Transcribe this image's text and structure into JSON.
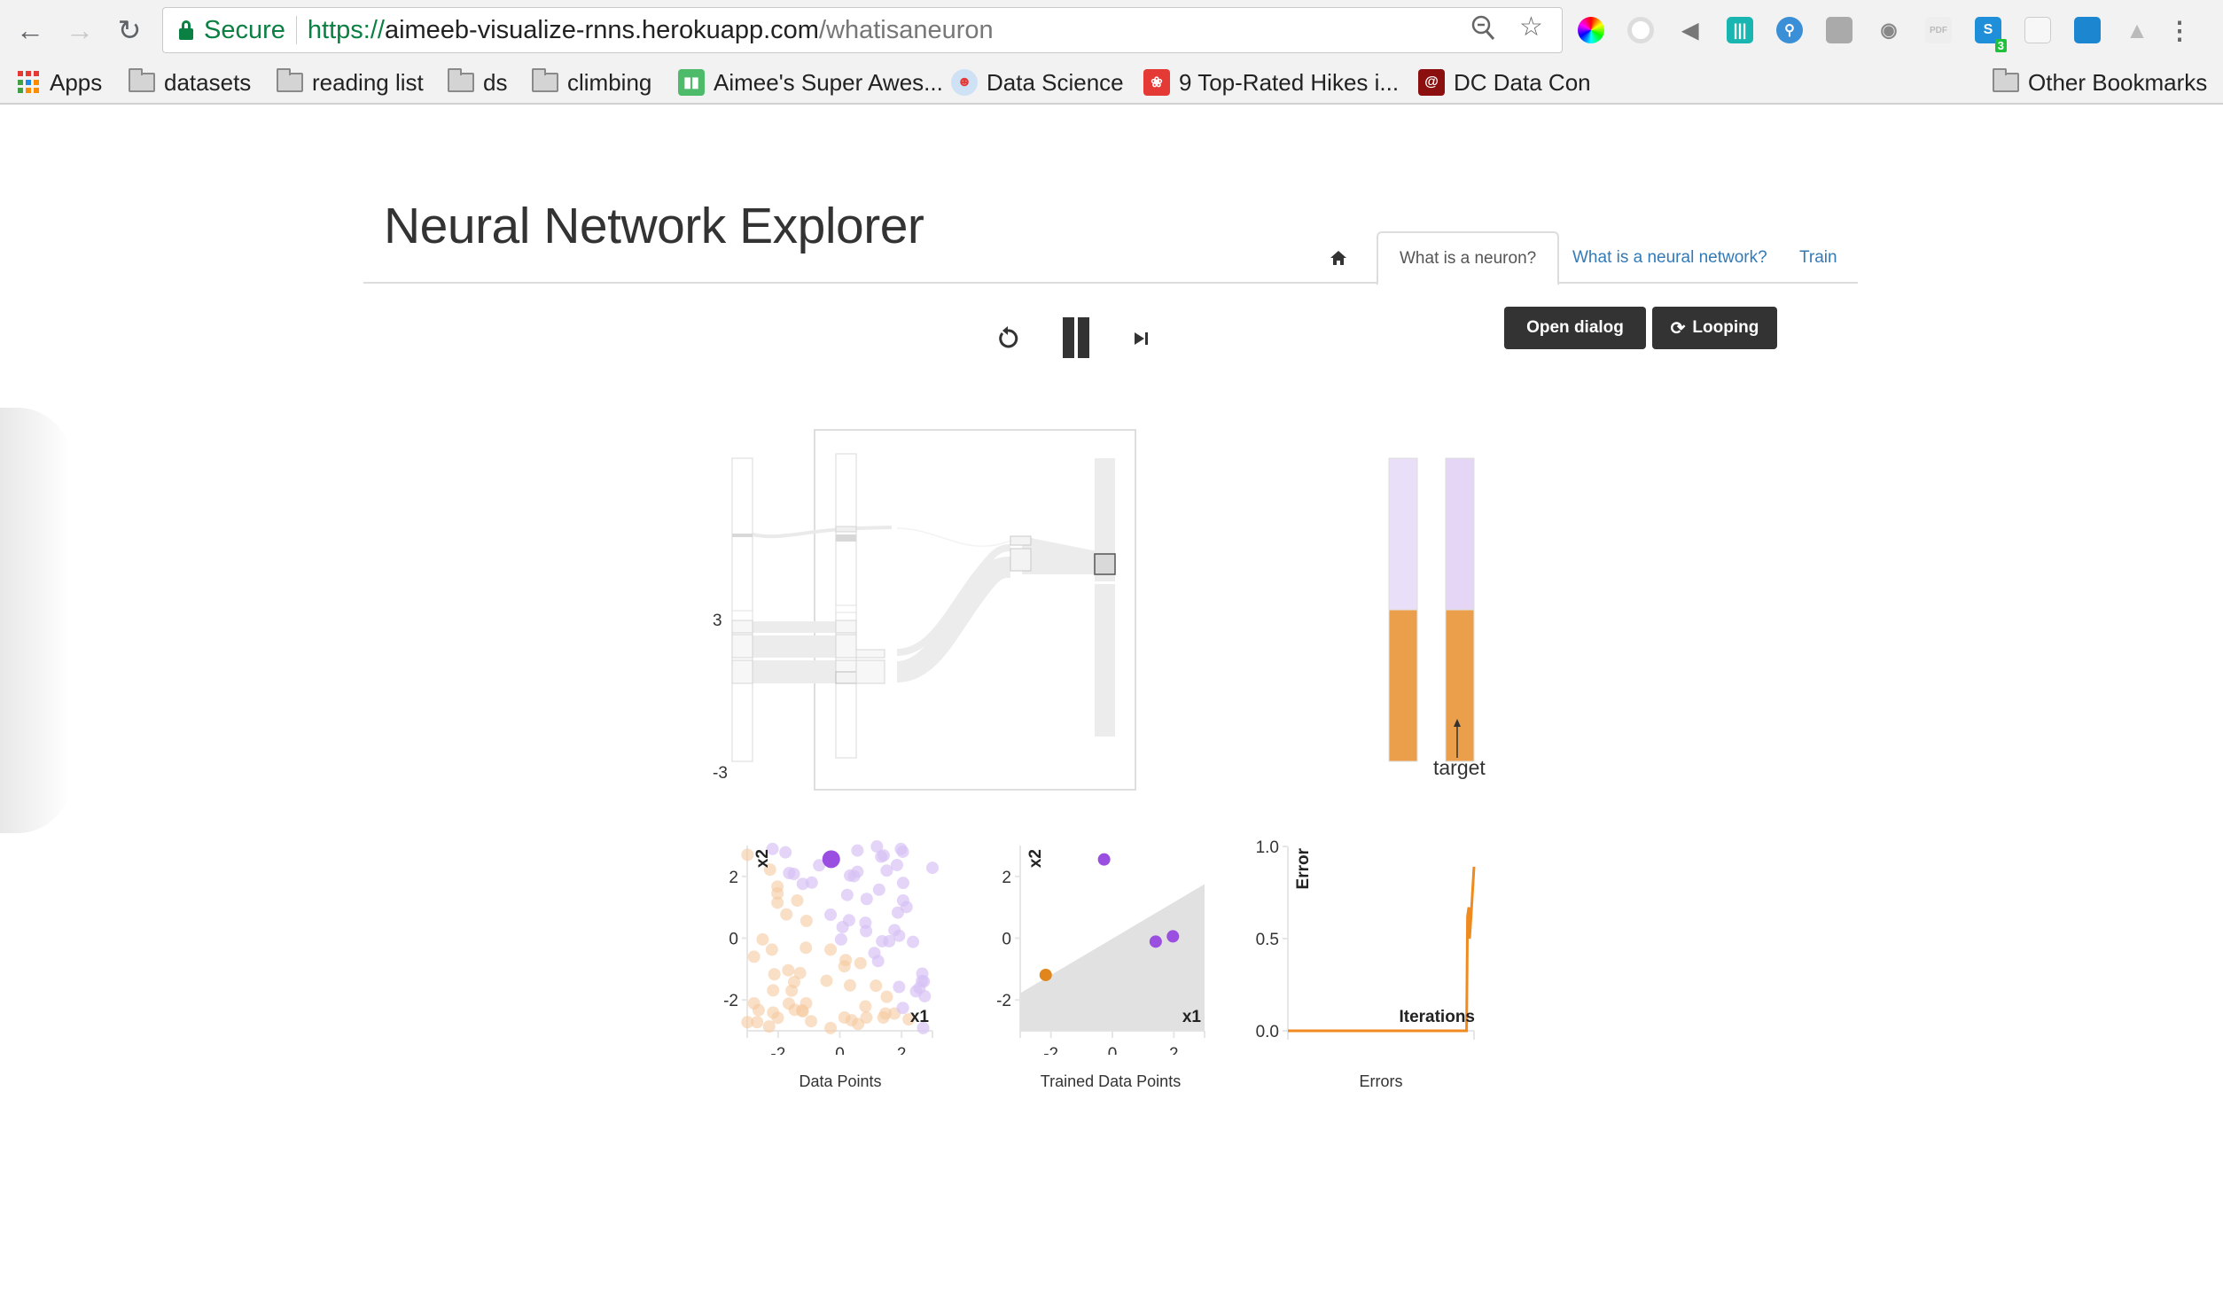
{
  "browser": {
    "back_icon": "arrow-left-icon",
    "forward_icon": "arrow-right-icon",
    "reload_icon": "reload-icon",
    "security_label": "Secure",
    "url_scheme": "https://",
    "url_host": "aimeeb-visualize-rnns.herokuapp.com",
    "url_path": "/whatisaneuron",
    "zoom_icon": "zoom-out-icon",
    "bookmark_star_icon": "star-icon",
    "extensions": [
      {
        "name": "color-picker-extension-icon"
      },
      {
        "name": "crescent-extension-icon"
      },
      {
        "name": "speaker-extension-icon"
      },
      {
        "name": "columns-extension-icon"
      },
      {
        "name": "search-extension-icon"
      },
      {
        "name": "note-extension-icon"
      },
      {
        "name": "camera-extension-icon"
      },
      {
        "name": "pdfjs-extension-icon",
        "label": "PDF"
      },
      {
        "name": "skype-extension-icon",
        "label": "S",
        "badge": "3"
      },
      {
        "name": "document-extension-icon"
      },
      {
        "name": "trello-extension-icon"
      },
      {
        "name": "drive-extension-icon"
      }
    ],
    "menu_icon": "more-vertical-icon",
    "bookmarks": [
      {
        "label": "Apps",
        "icon": "apps-grid-icon"
      },
      {
        "label": "datasets",
        "icon": "folder-icon"
      },
      {
        "label": "reading list",
        "icon": "folder-icon"
      },
      {
        "label": "ds",
        "icon": "folder-icon"
      },
      {
        "label": "climbing",
        "icon": "folder-icon"
      },
      {
        "label": "Aimee's Super Awes...",
        "icon": "trello-icon"
      },
      {
        "label": "Data Science",
        "icon": "reddit-icon"
      },
      {
        "label": "9 Top-Rated Hikes i...",
        "icon": "hikes-icon"
      },
      {
        "label": "DC Data Con",
        "icon": "dc-data-con-icon"
      }
    ],
    "other_bookmarks": "Other Bookmarks"
  },
  "page": {
    "title": "Neural Network Explorer",
    "tabs": [
      {
        "label": "home",
        "icon": "home-icon",
        "active": false
      },
      {
        "label": "What is a neuron?",
        "active": true
      },
      {
        "label": "What is a neural network?",
        "active": false
      },
      {
        "label": "Train",
        "active": false
      }
    ],
    "controls": {
      "restart_icon": "restart-icon",
      "pause_icon": "pause-icon",
      "step_icon": "step-forward-icon",
      "open_dialog_label": "Open dialog",
      "looping_label": "Looping",
      "looping_icon": "refresh-icon"
    },
    "neuron_diagram": {
      "axis_max_label": "3",
      "axis_min_label": "-3",
      "target_label": "target",
      "output_bars": [
        {
          "name": "prediction",
          "orange_fraction": 0.5
        },
        {
          "name": "target",
          "orange_fraction": 0.5
        }
      ],
      "colors": {
        "orange": "#eb9f4b",
        "lavender": "#eadff8",
        "lavender_target": "#e5d6f6",
        "gray_flow": "#ececec"
      }
    }
  },
  "chart_data": [
    {
      "type": "scatter",
      "title": "Data Points",
      "xlabel": "x1",
      "ylabel": "x2",
      "xlim": [
        -3,
        3
      ],
      "ylim": [
        -3,
        3
      ],
      "xticks": [
        -2,
        0,
        2
      ],
      "yticks": [
        -2,
        0,
        2
      ],
      "series": [
        {
          "name": "class-orange",
          "color": "#f5c9a0",
          "opacity": 0.6,
          "points": [
            [
              -2.99,
              2.7
            ],
            [
              -2.26,
              2.22
            ],
            [
              -2.02,
              1.67
            ],
            [
              -2.02,
              1.45
            ],
            [
              -2.02,
              1.15
            ],
            [
              -1.38,
              1.22
            ],
            [
              -1.73,
              0.77
            ],
            [
              -1.08,
              0.56
            ],
            [
              -2.5,
              -0.04
            ],
            [
              -2.2,
              -0.37
            ],
            [
              -2.78,
              -0.6
            ],
            [
              -1.1,
              -0.31
            ],
            [
              -0.3,
              -0.37
            ],
            [
              0.19,
              -0.71
            ],
            [
              0.15,
              -0.91
            ],
            [
              0.67,
              -0.81
            ],
            [
              -2.12,
              -1.17
            ],
            [
              -1.67,
              -1.04
            ],
            [
              -1.29,
              -1.13
            ],
            [
              -1.48,
              -1.42
            ],
            [
              -1.56,
              -1.7
            ],
            [
              -2.16,
              -1.69
            ],
            [
              -0.43,
              -1.38
            ],
            [
              0.33,
              -1.53
            ],
            [
              1.17,
              -1.54
            ],
            [
              1.52,
              -1.9
            ],
            [
              -2.78,
              -2.11
            ],
            [
              -2.63,
              -2.33
            ],
            [
              -2.16,
              -2.41
            ],
            [
              -2.01,
              -2.58
            ],
            [
              -1.65,
              -2.12
            ],
            [
              -1.46,
              -2.32
            ],
            [
              -1.09,
              -2.11
            ],
            [
              -1.22,
              -2.34
            ],
            [
              -1.2,
              -2.37
            ],
            [
              -2.99,
              -2.72
            ],
            [
              -2.68,
              -2.72
            ],
            [
              -2.29,
              -2.86
            ],
            [
              -0.93,
              -2.69
            ],
            [
              -0.3,
              -2.91
            ],
            [
              0.15,
              -2.57
            ],
            [
              0.38,
              -2.66
            ],
            [
              0.59,
              -2.78
            ],
            [
              0.83,
              -2.21
            ],
            [
              0.86,
              -2.57
            ],
            [
              1.41,
              -2.57
            ],
            [
              1.48,
              -2.44
            ],
            [
              1.77,
              -2.44
            ],
            [
              2.23,
              -2.63
            ]
          ]
        },
        {
          "name": "class-purple",
          "color": "#d7c2f5",
          "opacity": 0.7,
          "points": [
            [
              -2.18,
              2.89
            ],
            [
              -1.76,
              2.78
            ],
            [
              -0.67,
              2.36
            ],
            [
              -1.64,
              2.11
            ],
            [
              -1.49,
              2.08
            ],
            [
              -1.2,
              1.76
            ],
            [
              -0.91,
              1.8
            ],
            [
              0.57,
              2.84
            ],
            [
              1.2,
              2.97
            ],
            [
              1.34,
              2.64
            ],
            [
              1.42,
              2.68
            ],
            [
              1.98,
              2.89
            ],
            [
              2.04,
              2.8
            ],
            [
              1.85,
              2.37
            ],
            [
              1.52,
              2.19
            ],
            [
              3.0,
              2.28
            ],
            [
              0.33,
              2.03
            ],
            [
              0.46,
              2.01
            ],
            [
              0.57,
              2.15
            ],
            [
              2.05,
              1.79
            ],
            [
              0.24,
              1.4
            ],
            [
              0.87,
              1.27
            ],
            [
              1.27,
              1.57
            ],
            [
              2.05,
              1.22
            ],
            [
              2.16,
              1.01
            ],
            [
              -0.3,
              0.76
            ],
            [
              0.3,
              0.58
            ],
            [
              0.09,
              0.36
            ],
            [
              0.83,
              0.5
            ],
            [
              0.85,
              0.23
            ],
            [
              1.88,
              0.83
            ],
            [
              1.77,
              0.26
            ],
            [
              1.92,
              0.08
            ],
            [
              1.37,
              -0.1
            ],
            [
              1.6,
              -0.1
            ],
            [
              2.37,
              -0.12
            ],
            [
              0.04,
              -0.04
            ],
            [
              1.12,
              -0.48
            ],
            [
              1.24,
              -0.74
            ],
            [
              2.67,
              -1.15
            ],
            [
              2.66,
              -1.39
            ],
            [
              2.72,
              -1.4
            ],
            [
              1.92,
              -1.58
            ],
            [
              2.47,
              -1.72
            ],
            [
              2.58,
              -1.61
            ],
            [
              2.75,
              -1.88
            ],
            [
              2.04,
              -2.26
            ],
            [
              2.7,
              -2.91
            ]
          ]
        },
        {
          "name": "current-point",
          "color": "#9b4fe0",
          "opacity": 1,
          "large": true,
          "points": [
            [
              -0.28,
              2.56
            ]
          ]
        }
      ]
    },
    {
      "type": "scatter",
      "title": "Trained Data Points",
      "xlabel": "x1",
      "ylabel": "x2",
      "xlim": [
        -3,
        3
      ],
      "ylim": [
        -3,
        3
      ],
      "xticks": [
        -2,
        0,
        2
      ],
      "yticks": [
        -2,
        0,
        2
      ],
      "decision_boundary": {
        "x": [
          -3,
          3
        ],
        "y": [
          -1.78,
          1.75
        ],
        "fill": "#e1e1e1",
        "region": "below"
      },
      "series": [
        {
          "name": "class-purple",
          "color": "#9b4fe0",
          "points": [
            [
              -0.27,
              2.55
            ],
            [
              1.41,
              -0.11
            ],
            [
              1.97,
              0.06
            ]
          ]
        },
        {
          "name": "class-orange",
          "color": "#e0861c",
          "points": [
            [
              -2.17,
              -1.19
            ]
          ]
        }
      ]
    },
    {
      "type": "line",
      "title": "Errors",
      "xlabel": "Iterations",
      "ylabel": "Error",
      "ylim": [
        0,
        1
      ],
      "yticks": [
        "0.0",
        "0.5",
        "1.0"
      ],
      "xlim": [
        0,
        100
      ],
      "series": [
        {
          "name": "error",
          "color": "#ef8a1f",
          "x": [
            0,
            96,
            96.5,
            97.2,
            97.6,
            98.4,
            100
          ],
          "y": [
            0,
            0,
            0.62,
            0.67,
            0.5,
            0.62,
            0.89
          ]
        }
      ]
    }
  ]
}
